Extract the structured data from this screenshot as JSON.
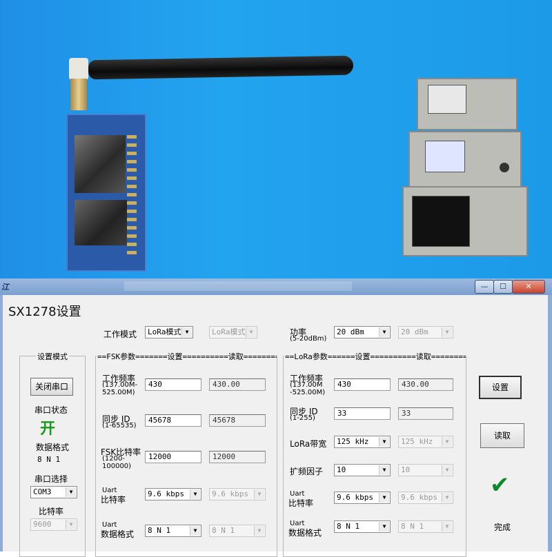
{
  "window": {
    "icon_glyph": "江",
    "app_title": "SX1278设置",
    "buttons": {
      "minimize": "—",
      "maximize": "☐",
      "close": "✕"
    }
  },
  "top": {
    "mode_label": "工作模式",
    "mode_value": "LoRa模式",
    "mode_read": "LoRa模式",
    "power_label": "功率",
    "power_range": "(5-20dBm)",
    "power_value": "20  dBm",
    "power_read": "20  dBm"
  },
  "left_panel": {
    "group_title": "设置模式",
    "toggle_port_button": "关闭串口",
    "port_status_label": "串口状态",
    "port_status_value": "开",
    "data_format_label": "数据格式",
    "data_format_value": "8  N  1",
    "port_select_label": "串口选择",
    "port_value": "COM3",
    "baud_label": "比特率",
    "baud_value": "9600"
  },
  "fsk": {
    "group_title": "==FSK参数=======设置==========读取=========",
    "freq_label": "工作频率",
    "freq_range1": "(137.00M-",
    "freq_range2": "525.00M)",
    "freq_set": "430",
    "freq_read": "430.00",
    "sync_label": "同步 ID",
    "sync_range": "(1-65535)",
    "sync_set": "45678",
    "sync_read": "45678",
    "bitrate_label": "FSK比特率",
    "bitrate_range1": "(1200-",
    "bitrate_range2": "100000)",
    "bitrate_set": "12000",
    "bitrate_read": "12000",
    "uart_rate_label1": "Uart",
    "uart_rate_label2": "比特率",
    "uart_rate_set": "9.6  kbps",
    "uart_rate_read": "9.6  kbps",
    "uart_fmt_label1": "Uart",
    "uart_fmt_label2": "数据格式",
    "uart_fmt_set": "8 N 1",
    "uart_fmt_read": "8 N 1"
  },
  "lora": {
    "group_title": "==LoRa参数======设置==========读取=========",
    "freq_label": "工作频率",
    "freq_range1": "(137.00M",
    "freq_range2": "-525.00M)",
    "freq_set": "430",
    "freq_read": "430.00",
    "sync_label": "同步 ID",
    "sync_range": "(1-255)",
    "sync_set": "33",
    "sync_read": "33",
    "bw_label": "LoRa带宽",
    "bw_set": "125  kHz",
    "bw_read": "125  kHz",
    "sf_label": "扩频因子",
    "sf_set": "10",
    "sf_read": "10",
    "uart_rate_label1": "Uart",
    "uart_rate_label2": "比特率",
    "uart_rate_set": "9.6  kbps",
    "uart_rate_read": "9.6  kbps",
    "uart_fmt_label1": "Uart",
    "uart_fmt_label2": "数据格式",
    "uart_fmt_set": "8 N 1",
    "uart_fmt_read": "8 N 1"
  },
  "actions": {
    "set_button": "设置",
    "read_button": "读取",
    "done_icon": "✔",
    "done_label": "完成"
  },
  "colors": {
    "photo_bg": "#1f8fe6",
    "status_green": "#1a9a1a",
    "check_green": "#0f8a2a",
    "titlebar": "#9db9df"
  }
}
